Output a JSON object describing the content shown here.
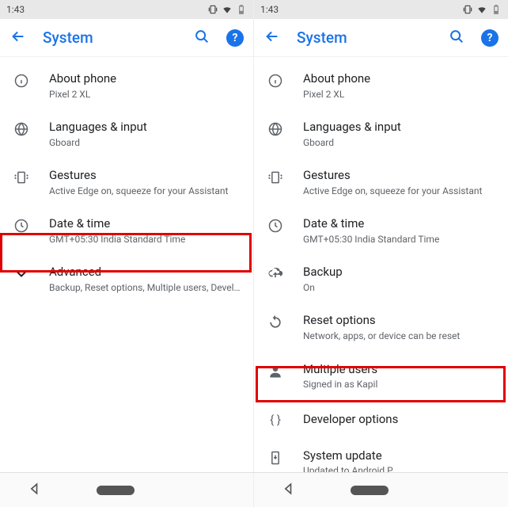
{
  "status": {
    "time": "1:43"
  },
  "header": {
    "title": "System"
  },
  "left": {
    "items": [
      {
        "title": "About phone",
        "sub": "Pixel 2 XL",
        "icon": "info"
      },
      {
        "title": "Languages & input",
        "sub": "Gboard",
        "icon": "globe"
      },
      {
        "title": "Gestures",
        "sub": "Active Edge on, squeeze for your Assistant",
        "icon": "gesture"
      },
      {
        "title": "Date & time",
        "sub": "GMT+05:30 India Standard Time",
        "icon": "clock"
      },
      {
        "title": "Advanced",
        "sub": "Backup, Reset options, Multiple users, Developer o..",
        "icon": "chevron-down"
      }
    ]
  },
  "right": {
    "items": [
      {
        "title": "About phone",
        "sub": "Pixel 2 XL",
        "icon": "info"
      },
      {
        "title": "Languages & input",
        "sub": "Gboard",
        "icon": "globe"
      },
      {
        "title": "Gestures",
        "sub": "Active Edge on, squeeze for your Assistant",
        "icon": "gesture"
      },
      {
        "title": "Date & time",
        "sub": "GMT+05:30 India Standard Time",
        "icon": "clock"
      },
      {
        "title": "Backup",
        "sub": "On",
        "icon": "cloud"
      },
      {
        "title": "Reset options",
        "sub": "Network, apps, or device can be reset",
        "icon": "reset"
      },
      {
        "title": "Multiple users",
        "sub": "Signed in as Kapil",
        "icon": "person"
      },
      {
        "title": "Developer options",
        "sub": "",
        "icon": "braces"
      },
      {
        "title": "System update",
        "sub": "Updated to Android P",
        "icon": "device-update"
      }
    ]
  }
}
